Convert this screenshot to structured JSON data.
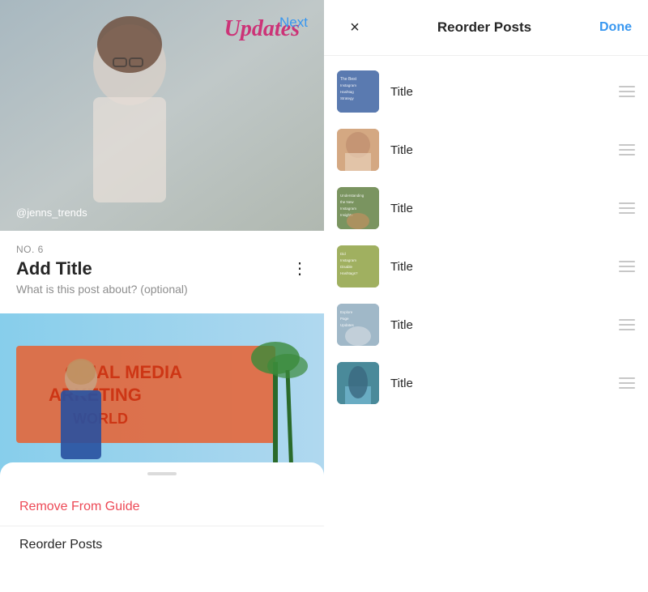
{
  "left_panel": {
    "next_button": "Next",
    "main_image": {
      "updates_text": "Updates",
      "username": "@jenns_trends"
    },
    "post": {
      "number": "NO. 6",
      "title": "Add Title",
      "subtitle": "What is this post about? (optional)"
    },
    "bottom_sheet": {
      "handle_label": "drag handle",
      "remove_label": "Remove From Guide",
      "reorder_label": "Reorder Posts"
    }
  },
  "right_panel": {
    "close_label": "×",
    "title": "Reorder Posts",
    "done_label": "Done",
    "items": [
      {
        "id": 1,
        "title": "Title"
      },
      {
        "id": 2,
        "title": "Title"
      },
      {
        "id": 3,
        "title": "Title"
      },
      {
        "id": 4,
        "title": "Title"
      },
      {
        "id": 5,
        "title": "Title"
      },
      {
        "id": 6,
        "title": "Title"
      }
    ]
  }
}
